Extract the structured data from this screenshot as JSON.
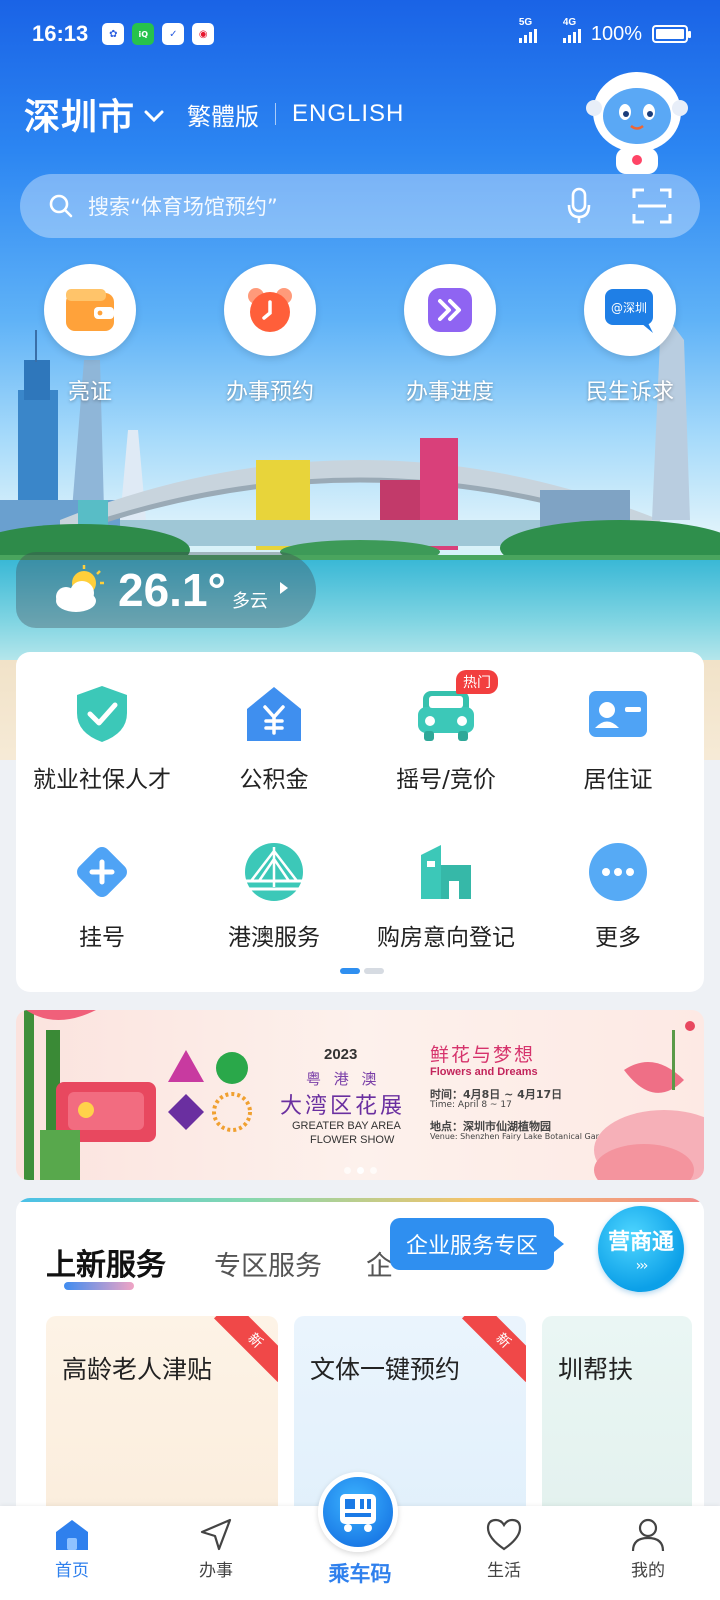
{
  "status_bar": {
    "time": "16:13",
    "app_icons": [
      "baidu-icon",
      "iqiyi-icon",
      "clipboard-icon",
      "weibo-icon"
    ],
    "network1": "5G",
    "network2": "4G",
    "battery": "100%"
  },
  "header": {
    "city": "深圳市",
    "lang_traditional": "繁體版",
    "lang_english": "ENGLISH"
  },
  "search": {
    "placeholder": "搜索“体育场馆预约”"
  },
  "quick_actions": [
    {
      "label": "亮证",
      "icon": "wallet-card-icon"
    },
    {
      "label": "办事预约",
      "icon": "alarm-clock-icon"
    },
    {
      "label": "办事进度",
      "icon": "fast-forward-icon"
    },
    {
      "label": "民生诉求",
      "icon": "chat-bubble-icon"
    }
  ],
  "weather": {
    "temperature": "26.1°",
    "condition": "多云"
  },
  "services": {
    "row1": [
      {
        "label": "就业社保人才",
        "icon": "shield-check-icon"
      },
      {
        "label": "公积金",
        "icon": "house-yuan-icon"
      },
      {
        "label": "摇号/竞价",
        "icon": "car-icon",
        "badge": "热门"
      },
      {
        "label": "居住证",
        "icon": "id-card-icon"
      }
    ],
    "row2": [
      {
        "label": "挂号",
        "icon": "medical-plus-icon"
      },
      {
        "label": "港澳服务",
        "icon": "bridge-icon"
      },
      {
        "label": "购房意向登记",
        "icon": "building-icon"
      },
      {
        "label": "更多",
        "icon": "more-dots-icon"
      }
    ],
    "page_count": 2,
    "active_page": 1
  },
  "banner": {
    "year": "2023",
    "line1": "粤 港 澳",
    "line2": "大湾区花展",
    "en1": "GREATER BAY AREA",
    "en2": "FLOWER SHOW",
    "title": "鲜花与梦想",
    "subtitle": "Flowers and Dreams",
    "time": "时间：4月8日 ~ 4月17日",
    "time_en": "Time: April 8 ~ 17",
    "venue": "地点：深圳市仙湖植物园",
    "venue_en": "Venue: Shenzhen Fairy Lake Botanical Garden"
  },
  "new_services": {
    "tab_active": "上新服务",
    "tab_2": "专区服务",
    "tab_3": "企",
    "tooltip": "企业服务专区",
    "yst_label": "营商通",
    "new_badge": "新",
    "cards": [
      {
        "title": "高龄老人津贴",
        "is_new": true
      },
      {
        "title": "文体一键预约",
        "is_new": true
      },
      {
        "title": "圳帮扶",
        "is_new": false
      }
    ]
  },
  "bottom_nav": {
    "home": "首页",
    "tasks": "办事",
    "ride": "乘车码",
    "life": "生活",
    "mine": "我的"
  },
  "colors": {
    "accent": "#2f80ed",
    "hot": "#f23f3f",
    "teal": "#3cc8b8"
  }
}
